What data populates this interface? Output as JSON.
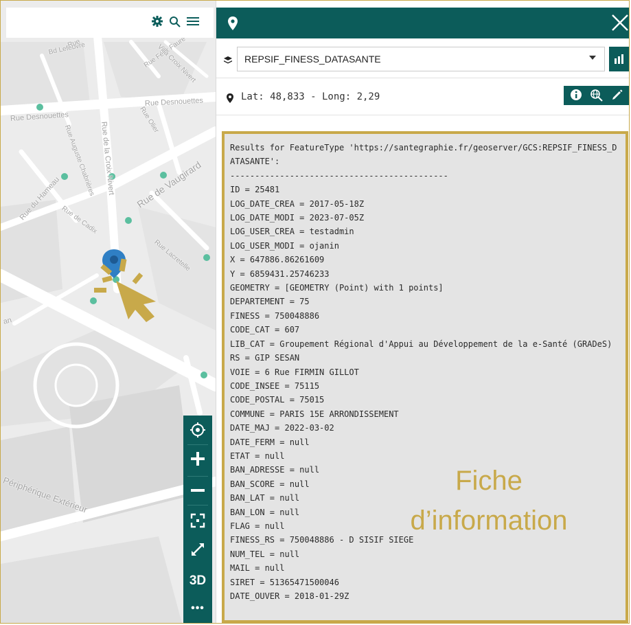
{
  "map": {
    "toolbar_icons": [
      "gear-icon",
      "search-icon",
      "hamburger-icon"
    ],
    "street_labels": [
      "Rue Desnouettes",
      "Rue Desnouettes",
      "Rue Auguste Chabrières",
      "Rue de la Croix Nivert",
      "Rue Olier",
      "Rue de Vaugirard",
      "Rue du Hameau",
      "Rue de Cadix",
      "Rue Lacretelle",
      "Rue Félix Faure",
      "Bd Lefebvre",
      "Rue",
      "Villa Croix Nivert",
      "Périphérique Extérieur",
      "an"
    ],
    "tools": [
      "locate-icon",
      "zoom-in-icon",
      "zoom-out-icon",
      "fit-extent-icon",
      "fullscreen-icon",
      "3D",
      "more-icon"
    ],
    "tools_3d_label": "3D",
    "tools_more_label": "•••"
  },
  "panel": {
    "header_icon": "map-marker-icon",
    "close_icon": "close-icon",
    "layer_select": {
      "value": "REPSIF_FINESS_DATASANTE"
    },
    "coordinates": "Lat: 48,833 - Long: 2,29",
    "coord_tools": [
      "info-icon",
      "globe-search-icon",
      "pencil-icon"
    ],
    "results_lines": [
      "Results for FeatureType 'https://santegraphie.fr/geoserver/GCS:REPSIF_FINESS_DATASANTE':",
      "--------------------------------------------",
      "ID = 25481",
      "LOG_DATE_CREA = 2017-05-18Z",
      "LOG_DATE_MODI = 2023-07-05Z",
      "LOG_USER_CREA = testadmin",
      "LOG_USER_MODI = ojanin",
      "X = 647886.86261609",
      "Y = 6859431.25746233",
      "GEOMETRY = [GEOMETRY (Point) with 1 points]",
      "DEPARTEMENT = 75",
      "FINESS = 750048886",
      "CODE_CAT = 607",
      "LIB_CAT = Groupement Régional d'Appui au Développement de la e-Santé (GRADeS)",
      "RS = GIP SESAN",
      "VOIE = 6 Rue FIRMIN GILLOT",
      "CODE_INSEE = 75115",
      "CODE_POSTAL = 75015",
      "COMMUNE = PARIS 15E ARRONDISSEMENT",
      "DATE_MAJ = 2022-03-02",
      "DATE_FERM = null",
      "ETAT = null",
      "BAN_ADRESSE = null",
      "BAN_SCORE = null",
      "BAN_LAT = null",
      "BAN_LON = null",
      "FLAG = null",
      "FINESS_RS = 750048886 - D SISIF SIEGE",
      "NUM_TEL = null",
      "MAIL = null",
      "SIRET = 51365471500046",
      "DATE_OUVER = 2018-01-29Z"
    ],
    "callout": {
      "line1": "Fiche",
      "line2": "d’information"
    }
  },
  "colors": {
    "brand": "#0c5c5a",
    "highlight": "#c8a94a",
    "poi": "#5bbf9f",
    "marker": "#2f7fc4"
  }
}
